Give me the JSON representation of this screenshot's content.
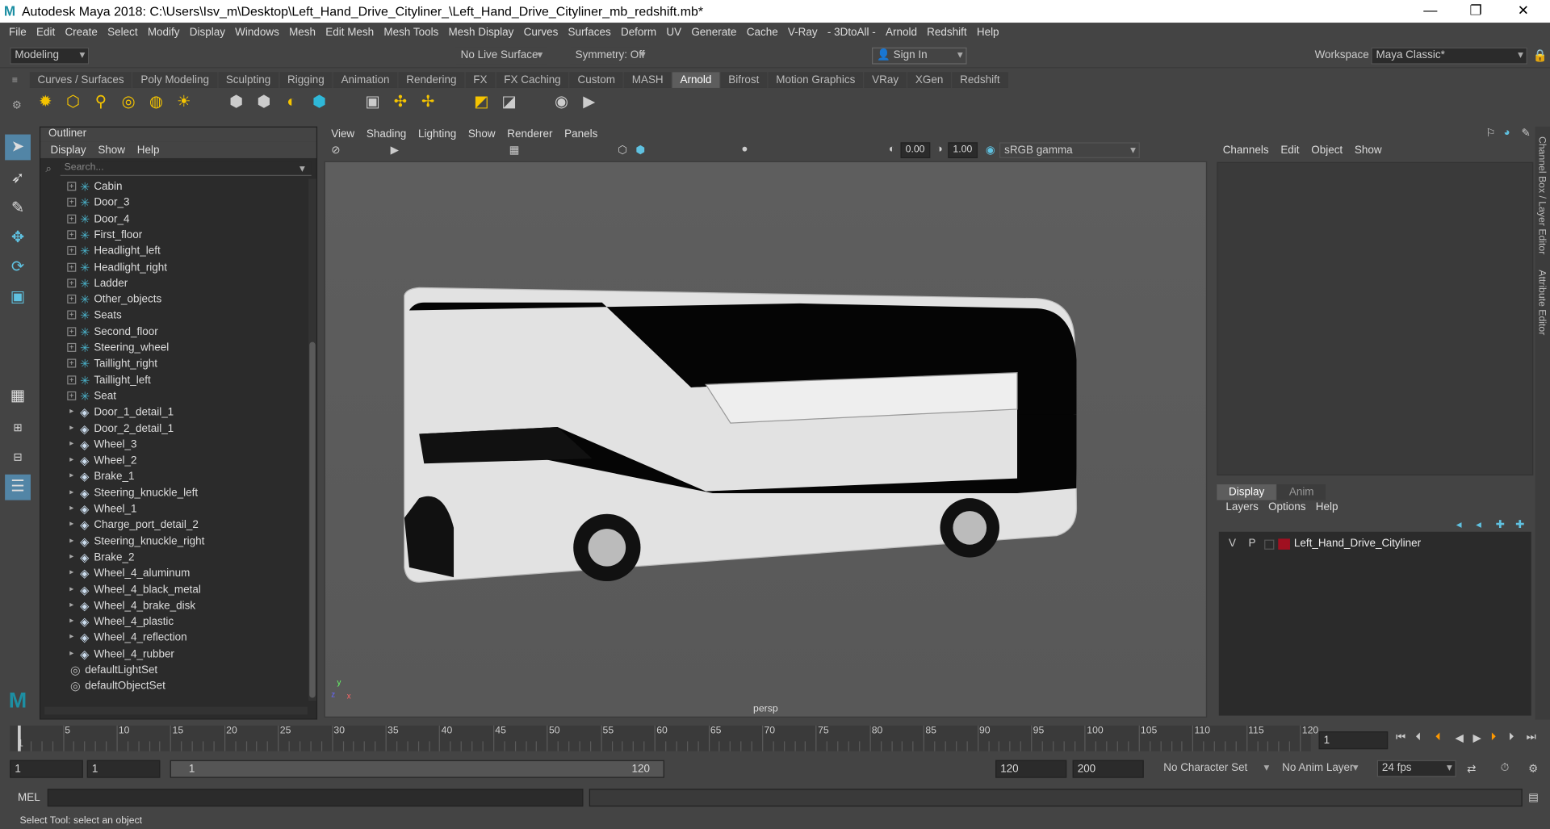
{
  "window": {
    "title": "Autodesk Maya 2018: C:\\Users\\Isv_m\\Desktop\\Left_Hand_Drive_Cityliner_\\Left_Hand_Drive_Cityliner_mb_redshift.mb*",
    "logo": "M",
    "min": "—",
    "max": "❐",
    "close": "✕"
  },
  "menus": [
    "File",
    "Edit",
    "Create",
    "Select",
    "Modify",
    "Display",
    "Windows",
    "Mesh",
    "Edit Mesh",
    "Mesh Tools",
    "Mesh Display",
    "Curves",
    "Surfaces",
    "Deform",
    "UV",
    "Generate",
    "Cache",
    "V-Ray",
    "- 3DtoAll -",
    "Arnold",
    "Redshift",
    "Help"
  ],
  "status": {
    "mode": "Modeling",
    "live_surface": "No Live Surface",
    "symmetry": "Symmetry: Off",
    "sign_in": "Sign In",
    "workspace_label": "Workspace :",
    "workspace": "Maya Classic*"
  },
  "shelf": {
    "tabs": [
      "Curves / Surfaces",
      "Poly Modeling",
      "Sculpting",
      "Rigging",
      "Animation",
      "Rendering",
      "FX",
      "FX Caching",
      "Custom",
      "MASH",
      "Arnold",
      "Bifrost",
      "Motion Graphics",
      "VRay",
      "XGen",
      "Redshift"
    ],
    "active": "Arnold"
  },
  "outliner": {
    "title": "Outliner",
    "menu": [
      "Display",
      "Show",
      "Help"
    ],
    "search_placeholder": "Search...",
    "items": [
      {
        "label": "Cabin",
        "type": "joint"
      },
      {
        "label": "Door_3",
        "type": "joint"
      },
      {
        "label": "Door_4",
        "type": "joint"
      },
      {
        "label": "First_floor",
        "type": "joint"
      },
      {
        "label": "Headlight_left",
        "type": "joint"
      },
      {
        "label": "Headlight_right",
        "type": "joint"
      },
      {
        "label": "Ladder",
        "type": "joint"
      },
      {
        "label": "Other_objects",
        "type": "joint"
      },
      {
        "label": "Seats",
        "type": "joint"
      },
      {
        "label": "Second_floor",
        "type": "joint"
      },
      {
        "label": "Steering_wheel",
        "type": "joint"
      },
      {
        "label": "Taillight_right",
        "type": "joint"
      },
      {
        "label": "Taillight_left",
        "type": "joint"
      },
      {
        "label": "Seat",
        "type": "joint"
      },
      {
        "label": "Door_1_detail_1",
        "type": "mesh"
      },
      {
        "label": "Door_2_detail_1",
        "type": "mesh"
      },
      {
        "label": "Wheel_3",
        "type": "mesh"
      },
      {
        "label": "Wheel_2",
        "type": "mesh"
      },
      {
        "label": "Brake_1",
        "type": "mesh"
      },
      {
        "label": "Steering_knuckle_left",
        "type": "mesh"
      },
      {
        "label": "Wheel_1",
        "type": "mesh"
      },
      {
        "label": "Charge_port_detail_2",
        "type": "mesh"
      },
      {
        "label": "Steering_knuckle_right",
        "type": "mesh"
      },
      {
        "label": "Brake_2",
        "type": "mesh"
      },
      {
        "label": "Wheel_4_aluminum",
        "type": "mesh"
      },
      {
        "label": "Wheel_4_black_metal",
        "type": "mesh"
      },
      {
        "label": "Wheel_4_brake_disk",
        "type": "mesh"
      },
      {
        "label": "Wheel_4_plastic",
        "type": "mesh"
      },
      {
        "label": "Wheel_4_reflection",
        "type": "mesh"
      },
      {
        "label": "Wheel_4_rubber",
        "type": "mesh"
      },
      {
        "label": "defaultLightSet",
        "type": "set"
      },
      {
        "label": "defaultObjectSet",
        "type": "set"
      }
    ]
  },
  "viewport": {
    "menu": [
      "View",
      "Shading",
      "Lighting",
      "Show",
      "Renderer",
      "Panels"
    ],
    "value_a": "0.00",
    "value_b": "1.00",
    "color_space": "sRGB gamma",
    "camera": "persp"
  },
  "channel_box": {
    "menu": [
      "Channels",
      "Edit",
      "Object",
      "Show"
    ]
  },
  "layer_editor": {
    "tabs": [
      "Display",
      "Anim"
    ],
    "active": "Display",
    "menu": [
      "Layers",
      "Options",
      "Help"
    ],
    "layer": {
      "v": "V",
      "p": "P",
      "name": "Left_Hand_Drive_Cityliner",
      "color": "#a01020"
    }
  },
  "side_tabs": [
    "Channel Box / Layer Editor",
    "Attribute Editor"
  ],
  "timeline": {
    "ticks": [
      "5",
      "10",
      "15",
      "20",
      "25",
      "30",
      "35",
      "40",
      "45",
      "50",
      "55",
      "60",
      "65",
      "70",
      "75",
      "80",
      "85",
      "90",
      "95",
      "100",
      "105",
      "110",
      "115",
      "120"
    ],
    "current": "1",
    "frame_field": "1"
  },
  "range": {
    "start": "1",
    "anim_start": "1",
    "slider_start": "1",
    "slider_end": "120",
    "end": "120",
    "anim_end": "200",
    "character_set": "No Character Set",
    "anim_layer": "No Anim Layer",
    "fps": "24 fps"
  },
  "mel": {
    "label": "MEL"
  },
  "help_line": "Select Tool: select an object"
}
